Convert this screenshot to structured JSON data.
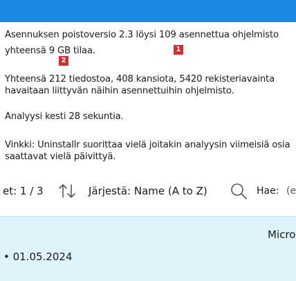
{
  "summary": {
    "line1": "Asennuksen poistoversio 2.3 löysi 109 asennettua ohjelmisto",
    "line2": "yhteensä 9 GB tilaa.",
    "line3": "Yhteensä 212 tiedostoa, 408 kansiota, 5420 rekisteriavainta",
    "line4": "havaitaan liittyvän näihin asennettuihin ohjelmisto.",
    "line5": "Analyysi kesti 28 sekuntia.",
    "line6": "Vinkki: Uninstallr suorittaa vielä joitakin analyysin viimeisiä osia",
    "line7": "saattavat vielä päivittyä."
  },
  "badges": {
    "b1": "1",
    "b2": "2"
  },
  "toolbar": {
    "page_indicator": "et: 1 / 3",
    "sort_label": "Järjestä: Name (A to Z)",
    "search_label": "Hae:",
    "search_placeholder": "(e"
  },
  "program": {
    "publisher": "Micro",
    "date": "• 01.05.2024"
  },
  "colors": {
    "topbar": "#1e88e5",
    "badge": "#d32f2f",
    "row_highlight": "#dff3fb"
  }
}
